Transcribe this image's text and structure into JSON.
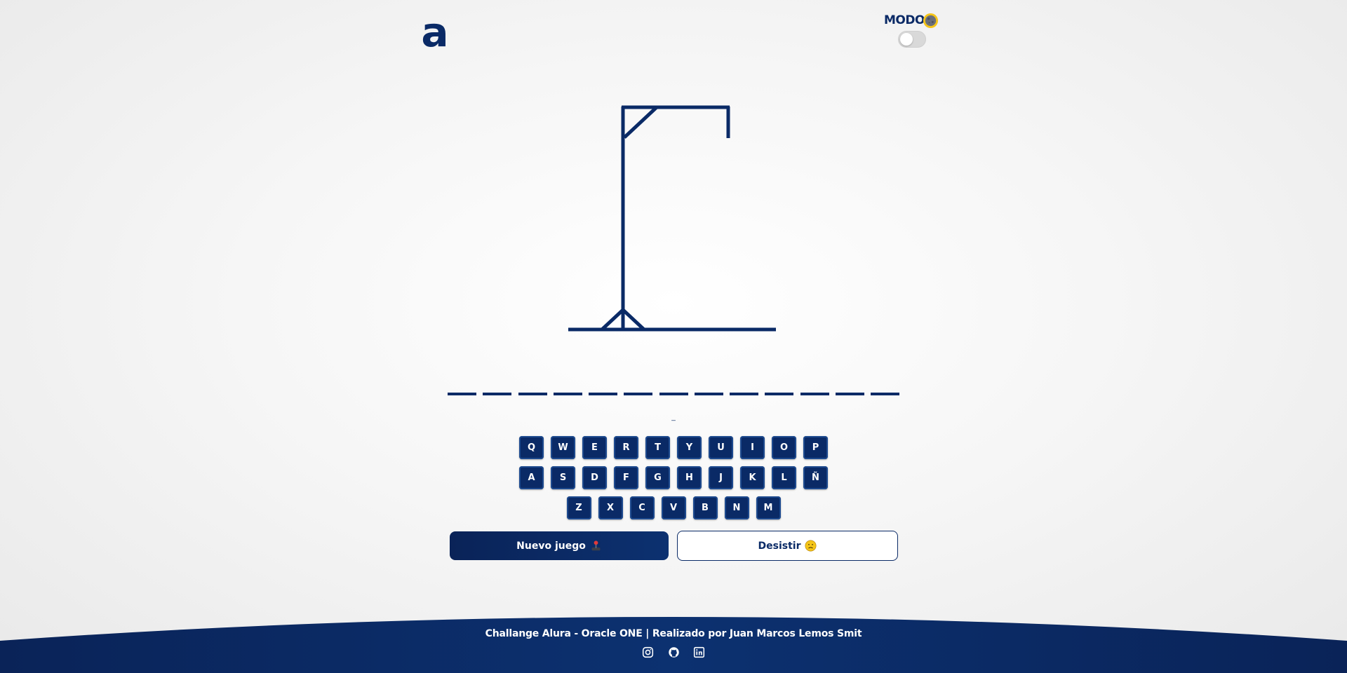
{
  "header": {
    "logo_letter": "a",
    "mode_label": "MODO"
  },
  "game": {
    "word_length": 13,
    "wrong_letters": "_"
  },
  "keyboard": {
    "row1": [
      "Q",
      "W",
      "E",
      "R",
      "T",
      "Y",
      "U",
      "I",
      "O",
      "P"
    ],
    "row2": [
      "A",
      "S",
      "D",
      "F",
      "G",
      "H",
      "J",
      "K",
      "L",
      "Ñ"
    ],
    "row3": [
      "Z",
      "X",
      "C",
      "V",
      "B",
      "N",
      "M"
    ]
  },
  "actions": {
    "new_game_label": "Nuevo juego",
    "new_game_icon": "joystick-icon",
    "quit_label": "Desistir",
    "quit_icon": "sad-face-icon"
  },
  "footer": {
    "credits": "Challange Alura - Oracle ONE | Realizado por Juan Marcos Lemos Smit",
    "social": [
      "instagram-icon",
      "github-icon",
      "linkedin-icon"
    ]
  },
  "colors": {
    "primary": "#0a2a66",
    "background": "#f4f4f4",
    "toggle": "#d9d9d9",
    "emoji_yellow": "#f5c518"
  }
}
